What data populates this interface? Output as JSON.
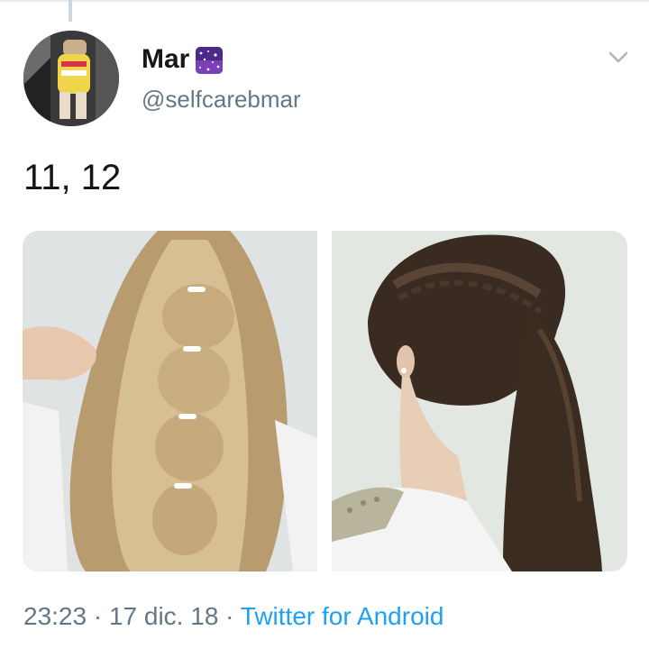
{
  "tweet": {
    "author": {
      "display_name": "Mar",
      "handle": "@selfcarebmar",
      "name_emoji": "galaxy-emoji"
    },
    "text": "11, 12",
    "media": [
      {
        "alt_icon": "bubble-ponytail-hairstyle-photo"
      },
      {
        "alt_icon": "braided-ponytail-hairstyle-photo"
      }
    ],
    "meta": {
      "time": "23:23",
      "separator": "·",
      "date": "17 dic. 18",
      "source": "Twitter for Android"
    },
    "menu_icon": "chevron-down-icon"
  },
  "colors": {
    "link": "#1da1f2",
    "secondary_text": "#657786",
    "primary_text": "#14171a"
  }
}
